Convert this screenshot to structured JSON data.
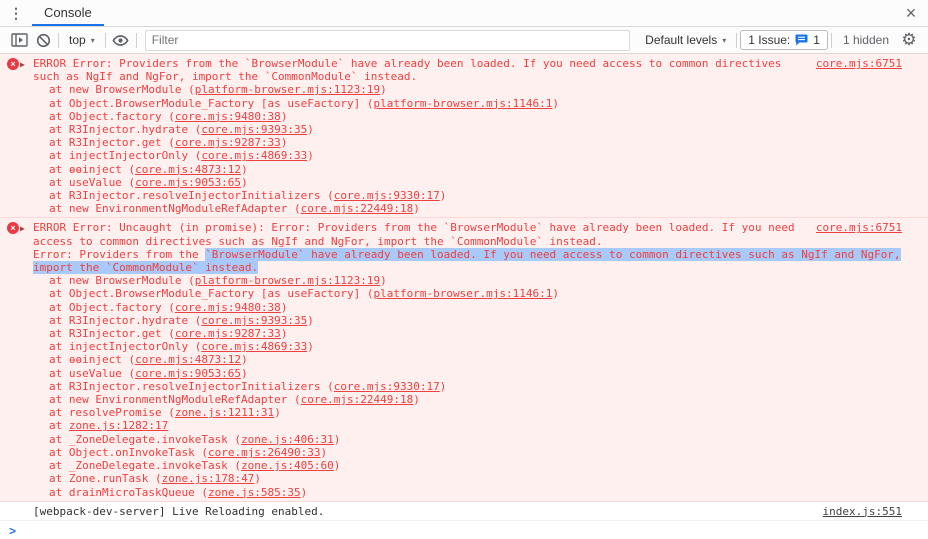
{
  "tabbar": {
    "tab_label": "Console",
    "kebab_glyph": "⋮",
    "close_glyph": "×"
  },
  "toolbar": {
    "context_label": "top",
    "caret_glyph": "▾",
    "filter_placeholder": "Filter",
    "levels_label": "Default levels",
    "issues_label": "1 Issue:",
    "issues_count": "1",
    "hidden_label": "1 hidden",
    "gear_glyph": "⚙"
  },
  "colors": {
    "accent": "#1a73e8",
    "error_text": "#ee4040",
    "error_bg": "#fff0f0",
    "error_border": "#ffd7d7",
    "selection": "#a9c9f8",
    "icon_gray": "#5f6368"
  },
  "icons": {
    "sidebar_toggle": "show-console-sidebar-icon",
    "clear_console": "clear-console-icon",
    "live_expression": "eye-icon",
    "issue_chat": "issue-chat-icon",
    "error_badge_glyph": "×",
    "expander_glyph": "▶",
    "prompt_glyph": ">"
  },
  "console": {
    "prompt_glyph": ">",
    "messages": [
      {
        "kind": "error",
        "expander": true,
        "source": "core.mjs:6751",
        "lines": [
          [
            {
              "t": "ERROR Error: Providers from the `BrowserModule` have already been loaded. If you need access to common directives"
            }
          ],
          [
            {
              "t": "such as NgIf and NgFor, import the `CommonModule` instead."
            }
          ]
        ],
        "stack": [
          {
            "pre": "at new BrowserModule (",
            "link": "platform-browser.mjs:1123:19",
            "post": ")"
          },
          {
            "pre": "at Object.BrowserModule_Factory [as useFactory] (",
            "link": "platform-browser.mjs:1146:1",
            "post": ")"
          },
          {
            "pre": "at Object.factory (",
            "link": "core.mjs:9480:38",
            "post": ")"
          },
          {
            "pre": "at R3Injector.hydrate (",
            "link": "core.mjs:9393:35",
            "post": ")"
          },
          {
            "pre": "at R3Injector.get (",
            "link": "core.mjs:9287:33",
            "post": ")"
          },
          {
            "pre": "at injectInjectorOnly (",
            "link": "core.mjs:4869:33",
            "post": ")"
          },
          {
            "pre": "at ɵɵinject (",
            "link": "core.mjs:4873:12",
            "post": ")"
          },
          {
            "pre": "at useValue (",
            "link": "core.mjs:9053:65",
            "post": ")"
          },
          {
            "pre": "at R3Injector.resolveInjectorInitializers (",
            "link": "core.mjs:9330:17",
            "post": ")"
          },
          {
            "pre": "at new EnvironmentNgModuleRefAdapter (",
            "link": "core.mjs:22449:18",
            "post": ")"
          }
        ]
      },
      {
        "kind": "error",
        "expander": true,
        "source": "core.mjs:6751",
        "lines": [
          [
            {
              "t": "ERROR Error: Uncaught (in promise): Error: Providers from the `BrowserModule` have already been loaded. If you need"
            }
          ],
          [
            {
              "t": "access to common directives such as NgIf and NgFor, import the `CommonModule` instead."
            }
          ],
          [
            {
              "t": "Error: Providers from the "
            },
            {
              "t": "`BrowserModule` have already been loaded. If you need access to common directives such as NgIf and NgFor,",
              "hl": true
            }
          ],
          [
            {
              "t": "import the `CommonModule` instead.",
              "hl": true
            }
          ]
        ],
        "stack": [
          {
            "pre": "at new BrowserModule (",
            "link": "platform-browser.mjs:1123:19",
            "post": ")"
          },
          {
            "pre": "at Object.BrowserModule_Factory [as useFactory] (",
            "link": "platform-browser.mjs:1146:1",
            "post": ")"
          },
          {
            "pre": "at Object.factory (",
            "link": "core.mjs:9480:38",
            "post": ")"
          },
          {
            "pre": "at R3Injector.hydrate (",
            "link": "core.mjs:9393:35",
            "post": ")"
          },
          {
            "pre": "at R3Injector.get (",
            "link": "core.mjs:9287:33",
            "post": ")"
          },
          {
            "pre": "at injectInjectorOnly (",
            "link": "core.mjs:4869:33",
            "post": ")"
          },
          {
            "pre": "at ɵɵinject (",
            "link": "core.mjs:4873:12",
            "post": ")"
          },
          {
            "pre": "at useValue (",
            "link": "core.mjs:9053:65",
            "post": ")"
          },
          {
            "pre": "at R3Injector.resolveInjectorInitializers (",
            "link": "core.mjs:9330:17",
            "post": ")"
          },
          {
            "pre": "at new EnvironmentNgModuleRefAdapter (",
            "link": "core.mjs:22449:18",
            "post": ")"
          },
          {
            "pre": "at resolvePromise (",
            "link": "zone.js:1211:31",
            "post": ")"
          },
          {
            "pre": "at ",
            "link": "zone.js:1282:17",
            "post": ""
          },
          {
            "pre": "at _ZoneDelegate.invokeTask (",
            "link": "zone.js:406:31",
            "post": ")"
          },
          {
            "pre": "at Object.onInvokeTask (",
            "link": "core.mjs:26490:33",
            "post": ")"
          },
          {
            "pre": "at _ZoneDelegate.invokeTask (",
            "link": "zone.js:405:60",
            "post": ")"
          },
          {
            "pre": "at Zone.runTask (",
            "link": "zone.js:178:47",
            "post": ")"
          },
          {
            "pre": "at drainMicroTaskQueue (",
            "link": "zone.js:585:35",
            "post": ")"
          }
        ]
      },
      {
        "kind": "log",
        "expander": false,
        "source": "index.js:551",
        "lines": [
          [
            {
              "t": "[webpack-dev-server] Live Reloading enabled."
            }
          ]
        ],
        "stack": []
      }
    ]
  }
}
